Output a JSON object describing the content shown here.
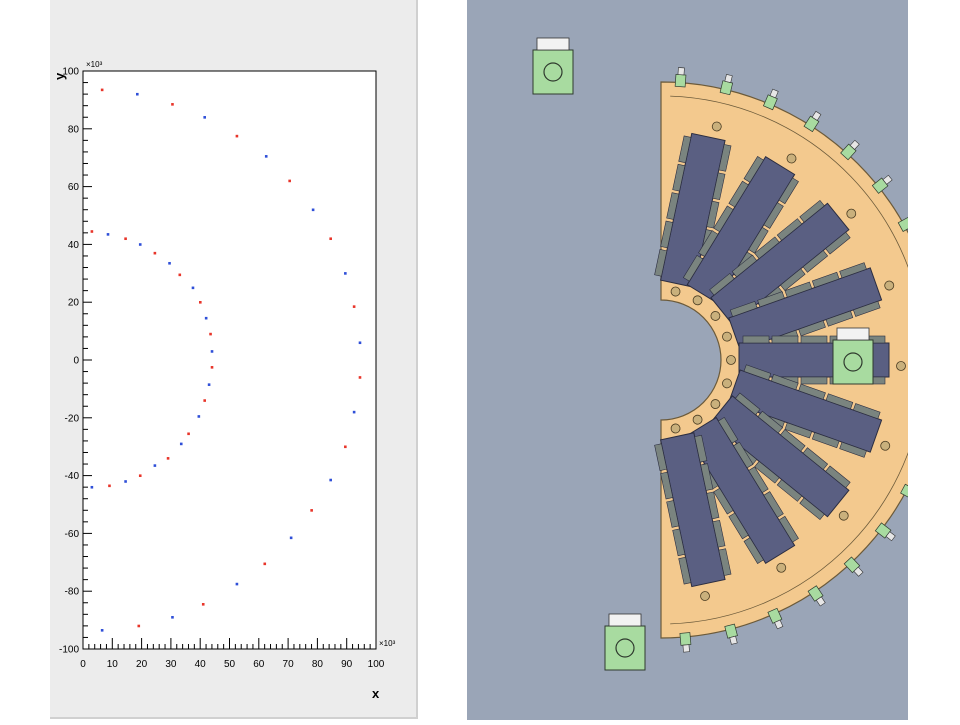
{
  "chart_data": {
    "type": "scatter",
    "xlabel": "x",
    "ylabel": "y",
    "x_exponent_label": "×10³",
    "y_exponent_label": "×10³",
    "xlim": [
      0,
      100
    ],
    "ylim": [
      -100,
      100
    ],
    "x_ticks": [
      "0",
      "10",
      "20",
      "30",
      "40",
      "50",
      "60",
      "70",
      "80",
      "90",
      "100"
    ],
    "y_ticks": [
      "100",
      "80",
      "60",
      "40",
      "20",
      "0",
      "-20",
      "-40",
      "-60",
      "-80",
      "-100"
    ],
    "grid": false,
    "series": [
      {
        "color": "#e8352a",
        "points": [
          [
            6.5,
            93.5
          ],
          [
            30.5,
            88.5
          ],
          [
            52.5,
            77.5
          ],
          [
            70.5,
            62
          ],
          [
            84.5,
            42
          ],
          [
            92.5,
            18.5
          ],
          [
            94.5,
            -6
          ],
          [
            89.5,
            -30
          ],
          [
            78,
            -52
          ],
          [
            62,
            -70.5
          ],
          [
            41,
            -84.5
          ],
          [
            19,
            -92
          ],
          [
            3,
            44.5
          ],
          [
            14.5,
            42
          ],
          [
            24.5,
            37
          ],
          [
            33,
            29.5
          ],
          [
            40,
            20
          ],
          [
            43.5,
            9
          ],
          [
            44,
            -2.5
          ],
          [
            41.5,
            -14
          ],
          [
            36,
            -25.5
          ],
          [
            29,
            -34
          ],
          [
            19.5,
            -40
          ],
          [
            9,
            -43.5
          ]
        ]
      },
      {
        "color": "#2f4fd8",
        "points": [
          [
            18.5,
            92
          ],
          [
            41.5,
            84
          ],
          [
            62.5,
            70.5
          ],
          [
            78.5,
            52
          ],
          [
            89.5,
            30
          ],
          [
            94.5,
            6
          ],
          [
            92.5,
            -18
          ],
          [
            84.5,
            -41.5
          ],
          [
            71,
            -61.5
          ],
          [
            52.5,
            -77.5
          ],
          [
            30.5,
            -89
          ],
          [
            6.5,
            -93.5
          ],
          [
            8.5,
            43.5
          ],
          [
            19.5,
            40
          ],
          [
            29.5,
            33.5
          ],
          [
            37.5,
            25
          ],
          [
            42,
            14.5
          ],
          [
            44,
            3
          ],
          [
            43,
            -8.5
          ],
          [
            39.5,
            -19.5
          ],
          [
            33.5,
            -29
          ],
          [
            24.5,
            -36.5
          ],
          [
            14.5,
            -42
          ],
          [
            3,
            -44
          ]
        ]
      }
    ]
  },
  "cad_drawing": {
    "background_color": "#9aa5b7",
    "frame_color": "#f3c98e",
    "module_color": "#5a5f82",
    "sensor_color": "#7a847f",
    "bracket_color": "#a8dba0"
  }
}
